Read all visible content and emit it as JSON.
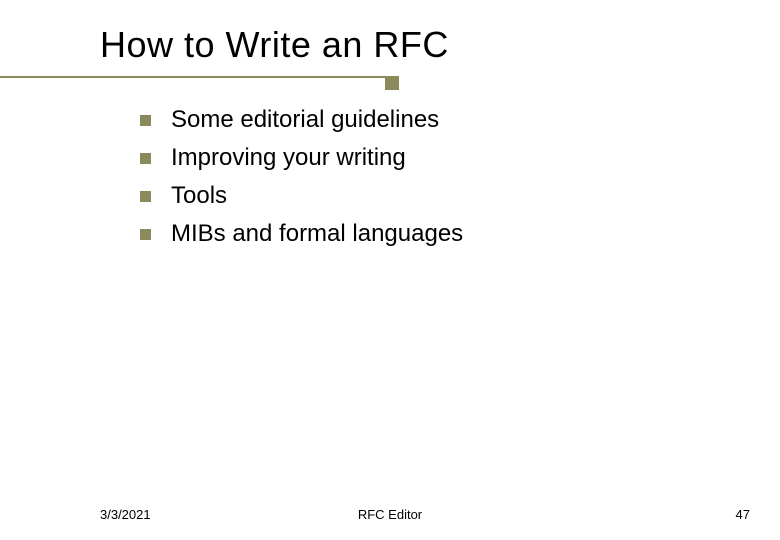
{
  "title": "How to Write an RFC",
  "bullets": [
    "Some editorial guidelines",
    "Improving your writing",
    "Tools",
    "MIBs and formal languages"
  ],
  "footer": {
    "date": "3/3/2021",
    "center": "RFC Editor",
    "page": "47"
  },
  "colors": {
    "accent": "#8a8a5c"
  }
}
